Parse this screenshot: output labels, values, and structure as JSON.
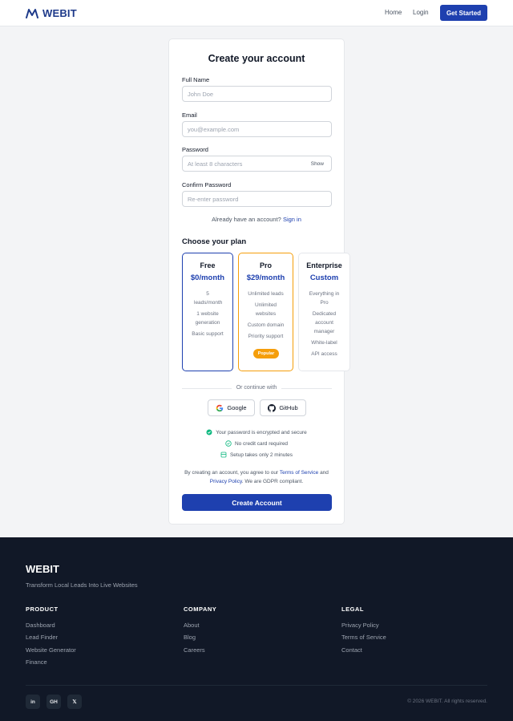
{
  "header": {
    "brand": "WEBIT",
    "nav": {
      "home": "Home",
      "login": "Login"
    },
    "cta": "Get Started"
  },
  "form": {
    "title": "Create your account",
    "full_name": {
      "label": "Full Name",
      "placeholder": "John Doe"
    },
    "email": {
      "label": "Email",
      "placeholder": "you@example.com"
    },
    "password": {
      "label": "Password",
      "placeholder": "At least 8 characters",
      "toggle": "Show"
    },
    "confirm": {
      "label": "Confirm Password",
      "placeholder": "Re-enter password"
    },
    "already": "Already have an account?",
    "signin": "Sign in",
    "plan_title": "Choose your plan",
    "plans": [
      {
        "name": "Free",
        "price": "$0/month",
        "features": [
          "5 leads/month",
          "1 website generation",
          "Basic support"
        ]
      },
      {
        "name": "Pro",
        "price": "$29/month",
        "features": [
          "Unlimited leads",
          "Unlimited websites",
          "Custom domain",
          "Priority support"
        ],
        "badge": "Popular"
      },
      {
        "name": "Enterprise",
        "price": "Custom",
        "features": [
          "Everything in Pro",
          "Dedicated account manager",
          "White-label",
          "API access"
        ]
      }
    ],
    "or_continue": "Or continue with",
    "google": "Google",
    "github": "GitHub",
    "trust": [
      "Your password is encrypted and secure",
      "No credit card required",
      "Setup takes only 2 minutes"
    ],
    "terms_prefix": "By creating an account, you agree to our",
    "terms_link": "Terms of Service",
    "terms_and": "and",
    "privacy_link": "Privacy Policy",
    "terms_suffix": ". We are GDPR compliant.",
    "submit": "Create Account"
  },
  "footer": {
    "brand": "WEBIT",
    "tagline": "Transform Local Leads Into Live Websites",
    "columns": [
      {
        "heading": "PRODUCT",
        "links": [
          "Dashboard",
          "Lead Finder",
          "Website Generator",
          "Finance"
        ]
      },
      {
        "heading": "COMPANY",
        "links": [
          "About",
          "Blog",
          "Careers"
        ]
      },
      {
        "heading": "LEGAL",
        "links": [
          "Privacy Policy",
          "Terms of Service",
          "Contact"
        ]
      }
    ],
    "social": [
      "in",
      "GH",
      "𝕏"
    ],
    "copyright": "© 2026 WEBIT. All rights reserved."
  },
  "colors": {
    "brand_blue": "#1e40af",
    "pro_accent": "#f59e0b",
    "trust_green": "#10b981",
    "footer_bg": "#111827"
  }
}
